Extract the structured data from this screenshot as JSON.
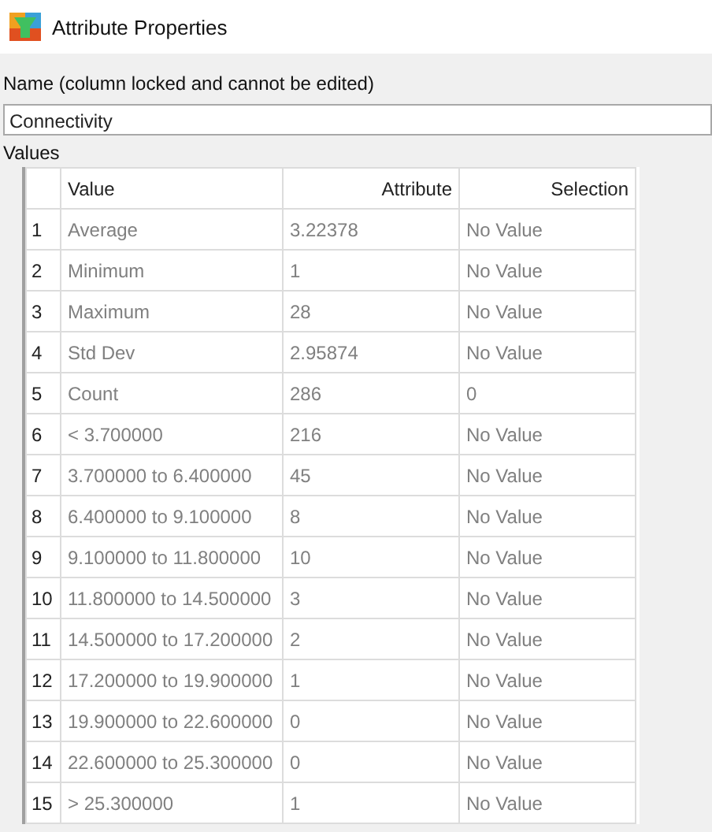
{
  "window": {
    "title": "Attribute Properties"
  },
  "name_field": {
    "label": "Name (column locked and cannot be edited)",
    "value": "Connectivity"
  },
  "values_label": "Values",
  "table": {
    "columns": [
      "Value",
      "Attribute",
      "Selection"
    ],
    "rows": [
      {
        "number": "1",
        "value": "Average",
        "attribute": "3.22378",
        "selection": "No Value"
      },
      {
        "number": "2",
        "value": "Minimum",
        "attribute": "1",
        "selection": "No Value"
      },
      {
        "number": "3",
        "value": "Maximum",
        "attribute": "28",
        "selection": "No Value"
      },
      {
        "number": "4",
        "value": "Std Dev",
        "attribute": "2.95874",
        "selection": "No Value"
      },
      {
        "number": "5",
        "value": "Count",
        "attribute": "286",
        "selection": "0"
      },
      {
        "number": "6",
        "value": "< 3.700000",
        "attribute": "216",
        "selection": "No Value"
      },
      {
        "number": "7",
        "value": "3.700000 to 6.400000",
        "attribute": "45",
        "selection": "No Value"
      },
      {
        "number": "8",
        "value": "6.400000 to 9.100000",
        "attribute": "8",
        "selection": "No Value"
      },
      {
        "number": "9",
        "value": "9.100000 to 11.800000",
        "attribute": "10",
        "selection": "No Value"
      },
      {
        "number": "10",
        "value": "11.800000 to 14.500000",
        "attribute": "3",
        "selection": "No Value"
      },
      {
        "number": "11",
        "value": "14.500000 to 17.200000",
        "attribute": "2",
        "selection": "No Value"
      },
      {
        "number": "12",
        "value": "17.200000 to 19.900000",
        "attribute": "1",
        "selection": "No Value"
      },
      {
        "number": "13",
        "value": "19.900000 to 22.600000",
        "attribute": "0",
        "selection": "No Value"
      },
      {
        "number": "14",
        "value": "22.600000 to 25.300000",
        "attribute": "0",
        "selection": "No Value"
      },
      {
        "number": "15",
        "value": "> 25.300000",
        "attribute": "1",
        "selection": "No Value"
      }
    ]
  }
}
